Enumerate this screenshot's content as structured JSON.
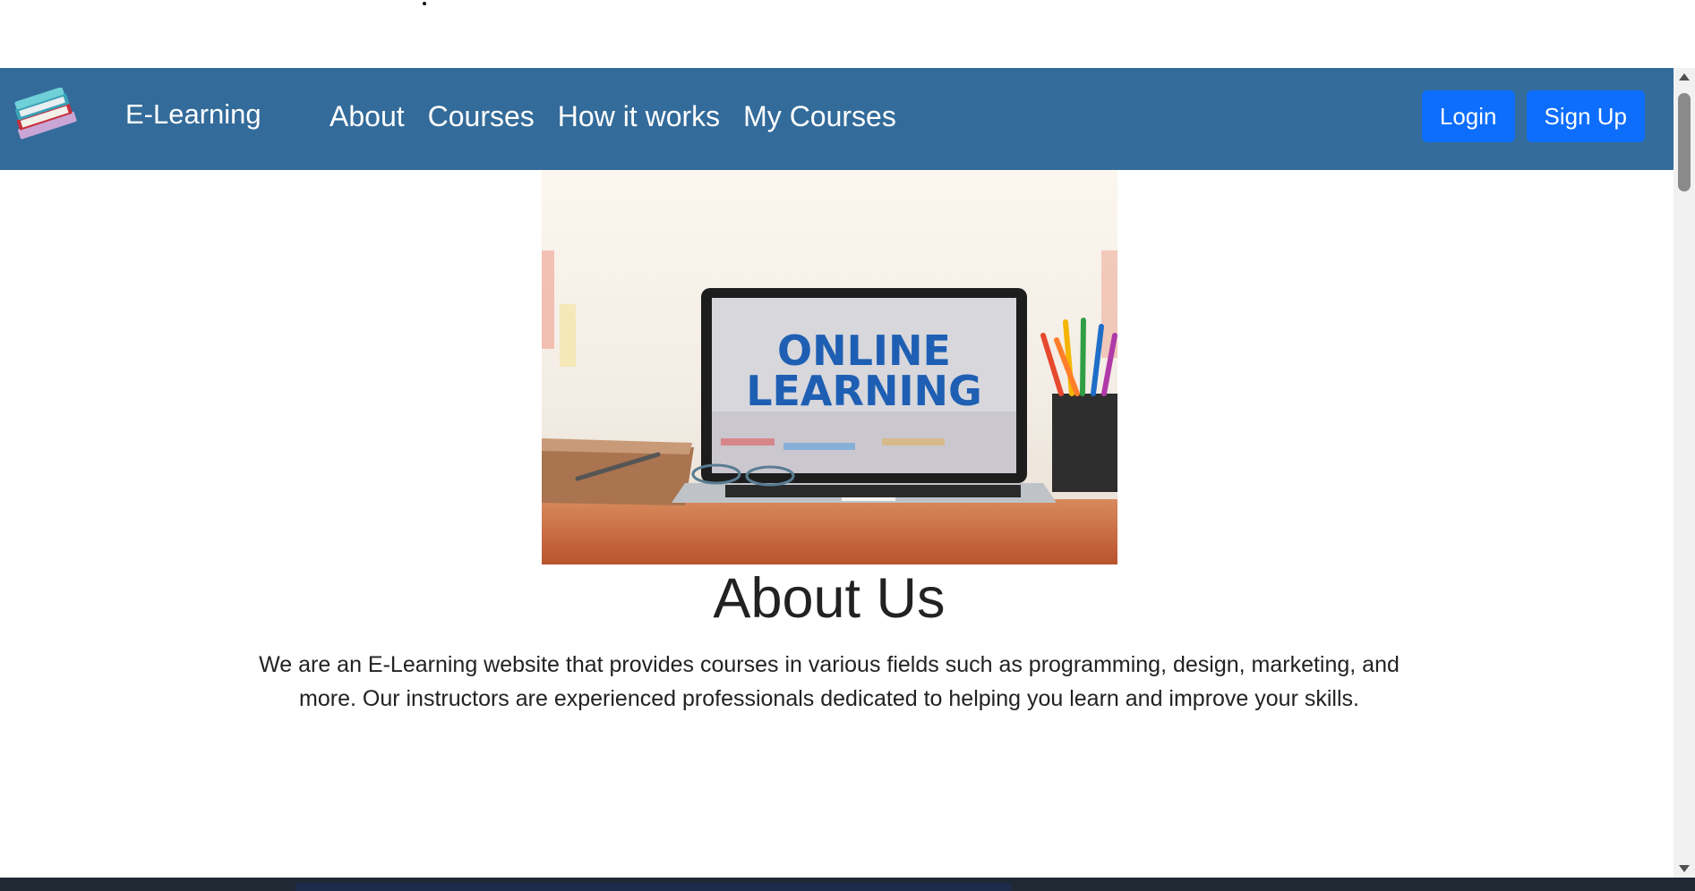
{
  "navbar": {
    "brand": "E-Learning",
    "links": [
      "About",
      "Courses",
      "How it works",
      "My Courses"
    ],
    "login_label": "Login",
    "signup_label": "Sign Up"
  },
  "hero": {
    "image_caption_line1": "ONLINE",
    "image_caption_line2": "LEARNING"
  },
  "about": {
    "title": "About Us",
    "text": "We are an E-Learning website that provides courses in various fields such as programming, design, marketing, and more. Our instructors are experienced professionals dedicated to helping you learn and improve your skills."
  },
  "colors": {
    "navbar_bg": "#336b9a",
    "button_bg": "#0d6efd"
  },
  "icons": [
    "books-logo-icon",
    "scroll-up-icon",
    "scroll-down-icon"
  ]
}
